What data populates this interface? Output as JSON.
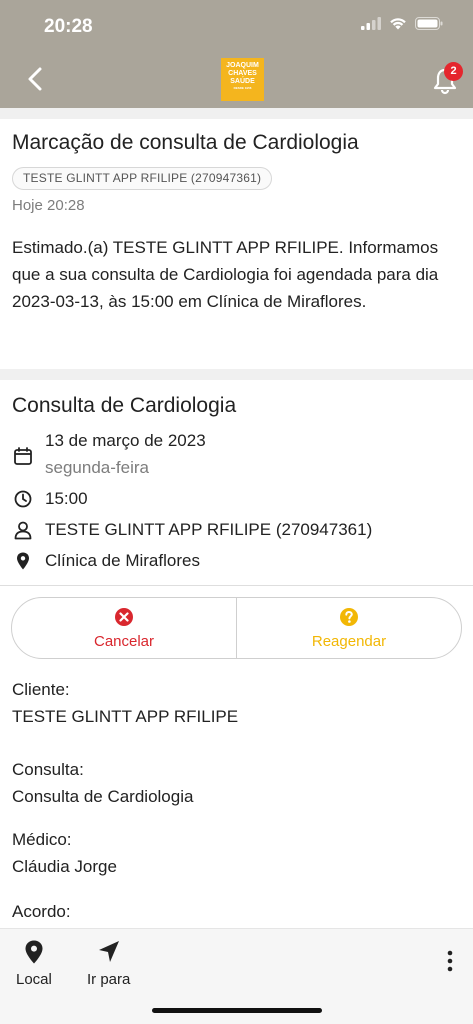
{
  "status_bar": {
    "time": "20:28"
  },
  "header": {
    "logo_line1": "JOAQUIM",
    "logo_line2": "CHAVES",
    "logo_line3": "SAÚDE",
    "logo_sub": "DESDE 1956",
    "notification_count": "2"
  },
  "message": {
    "title": "Marcação de consulta de Cardiologia",
    "patient_chip": "TESTE GLINTT APP RFILIPE (270947361)",
    "time": "Hoje 20:28",
    "body": "Estimado.(a) TESTE GLINTT APP RFILIPE. Informamos que a sua consulta de Cardiologia foi agendada para dia 2023-03-13, às 15:00 em Clínica de Miraflores."
  },
  "appointment": {
    "title": "Consulta de Cardiologia",
    "date": "13 de março de 2023",
    "weekday": "segunda-feira",
    "time": "15:00",
    "patient": "TESTE GLINTT APP RFILIPE (270947361)",
    "location": "Clínica de Miraflores"
  },
  "actions": {
    "cancel_label": "Cancelar",
    "reschedule_label": "Reagendar"
  },
  "details": {
    "client_label": "Cliente:",
    "client_value": "TESTE GLINTT APP RFILIPE",
    "consult_label": "Consulta:",
    "consult_value": "Consulta de Cardiologia",
    "doctor_label": "Médico:",
    "doctor_value": "Cláudia Jorge",
    "agreement_label": "Acordo:"
  },
  "bottom_bar": {
    "local_label": "Local",
    "goto_label": "Ir para"
  },
  "colors": {
    "header_bg": "#aaa59a",
    "brand_yellow": "#f4b51e",
    "cancel_red": "#d9272e",
    "reschedule_yellow": "#f2b705",
    "badge_red": "#e5262d"
  }
}
